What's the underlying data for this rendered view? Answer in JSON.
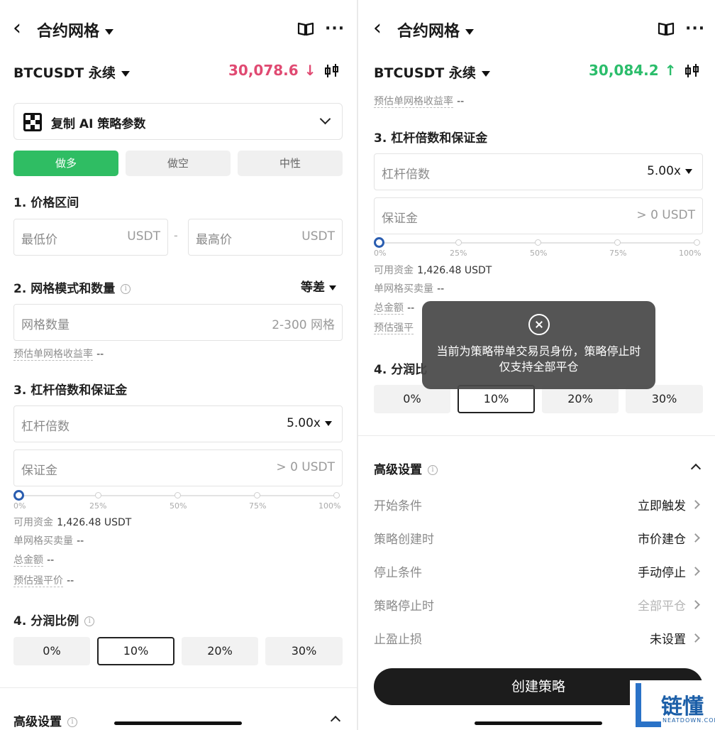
{
  "header": {
    "title": "合约网格",
    "book_icon": "book-icon",
    "more_icon": "more-dots-icon"
  },
  "left": {
    "pair": "BTCUSDT 永续",
    "price": "30,078.6",
    "price_arrow": "↓",
    "price_color": "#e04a72",
    "copy_ai_label": "复制 AI 策略参数",
    "directions": [
      "做多",
      "做空",
      "中性"
    ],
    "active_direction": "做多",
    "section1_title": "1. 价格区间",
    "min_price_placeholder": "最低价",
    "max_price_placeholder": "最高价",
    "unit": "USDT",
    "range_sep": "-",
    "section2_title": "2. 网格模式和数量",
    "grid_mode": "等差",
    "grid_count_placeholder": "网格数量",
    "grid_count_hint": "2-300 网格",
    "est_return_label": "预估单网格收益率",
    "est_return_value": "--"
  },
  "shared": {
    "section3_title": "3. 杠杆倍数和保证金",
    "leverage_label": "杠杆倍数",
    "leverage_value": "5.00x",
    "margin_label": "保证金",
    "margin_hint": "> 0 USDT",
    "slider_labels": [
      "0%",
      "25%",
      "50%",
      "75%",
      "100%"
    ],
    "slider_value_percent": 0,
    "available_label": "可用资金",
    "available_value": "1,426.48 USDT",
    "per_grid_qty_label": "单网格买卖量",
    "per_grid_qty_value": "--",
    "total_label": "总金额",
    "total_value": "--",
    "liq_label": "预估强平价",
    "liq_value": "--",
    "section4_title": "4. 分润比例",
    "share_options": [
      "0%",
      "10%",
      "20%",
      "30%"
    ],
    "active_share": "10%",
    "advanced_title": "高级设置"
  },
  "right": {
    "pair": "BTCUSDT 永续",
    "price": "30,084.2",
    "price_arrow": "↑",
    "price_color": "#2bbd6b",
    "est_return_label": "预估单网格收益率",
    "est_return_value": "--",
    "section4_partial": "4. 分润比",
    "liq_partial": "预估强平",
    "total_partial_value": "--",
    "toast_message": "当前为策略带单交易员身份，策略停止时仅支持全部平仓",
    "advanced_rows": [
      {
        "label": "开始条件",
        "value": "立即触发",
        "disabled": false
      },
      {
        "label": "策略创建时",
        "value": "市价建仓",
        "disabled": false
      },
      {
        "label": "停止条件",
        "value": "手动停止",
        "disabled": false
      },
      {
        "label": "策略停止时",
        "value": "全部平仓",
        "disabled": true
      },
      {
        "label": "止盈止损",
        "value": "未设置",
        "disabled": false
      }
    ],
    "create_button": "创建策略"
  },
  "watermark": {
    "text": "链懂",
    "sub": "NEATDOWN.COM"
  }
}
